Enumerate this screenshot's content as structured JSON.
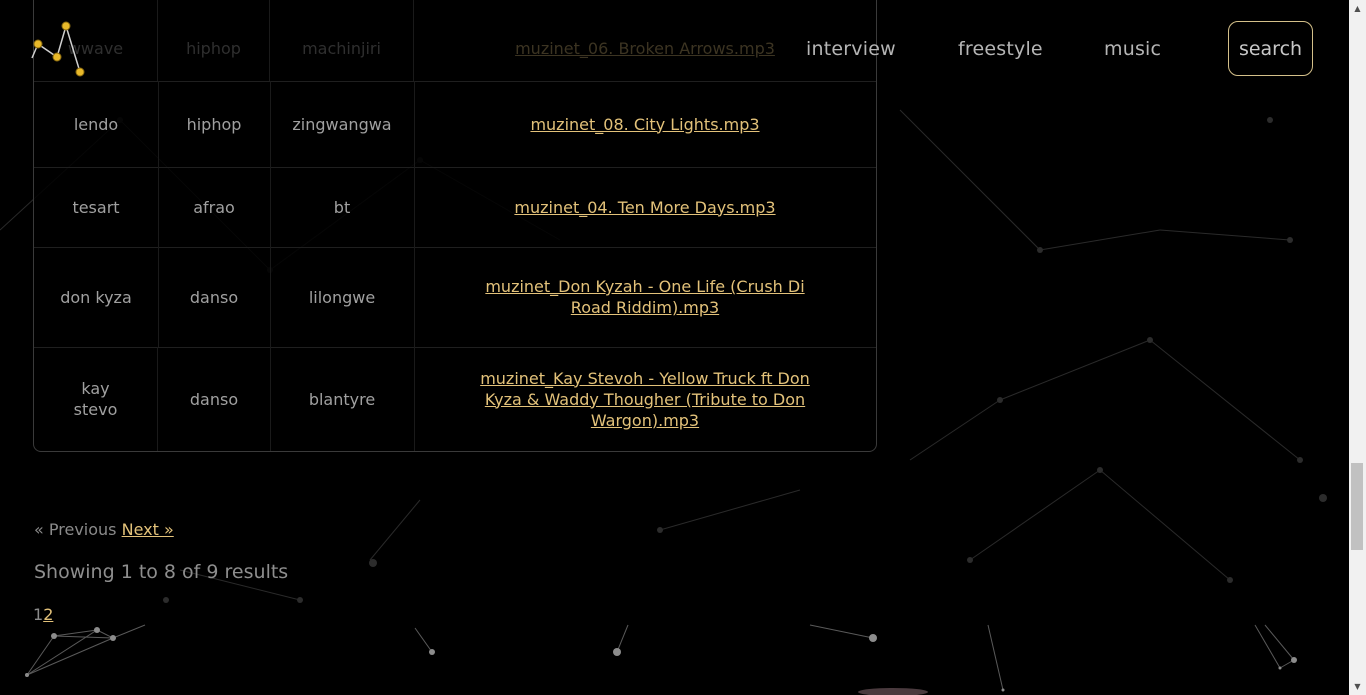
{
  "header": {
    "nav": {
      "interview": "interview",
      "freestyle": "freestyle",
      "music": "music"
    },
    "search_label": "search",
    "accent_color": "#e3c27a"
  },
  "table": {
    "rows": [
      {
        "artist": "wwave",
        "genre": "hiphop",
        "location": "machinjiri",
        "file": "muzinet_06. Broken Arrows.mp3"
      },
      {
        "artist": "lendo",
        "genre": "hiphop",
        "location": "zingwangwa",
        "file": "muzinet_08. City Lights.mp3"
      },
      {
        "artist": "tesart",
        "genre": "afrao",
        "location": "bt",
        "file": "muzinet_04. Ten More Days.mp3"
      },
      {
        "artist": "don kyza",
        "genre": "danso",
        "location": "lilongwe",
        "file": "muzinet_Don Kyzah - One Life (Crush Di Road Riddim).mp3"
      },
      {
        "artist": "kay stevo",
        "genre": "danso",
        "location": "blantyre",
        "file": "muzinet_Kay Stevoh - Yellow Truck ft Don Kyza & Waddy Thougher (Tribute to Don Wargon).mp3"
      }
    ]
  },
  "pagination": {
    "previous": "« Previous",
    "next": "Next »",
    "results_text": "Showing 1 to 8 of 9 results",
    "pages": [
      "1",
      "2"
    ],
    "current_page": "1"
  }
}
